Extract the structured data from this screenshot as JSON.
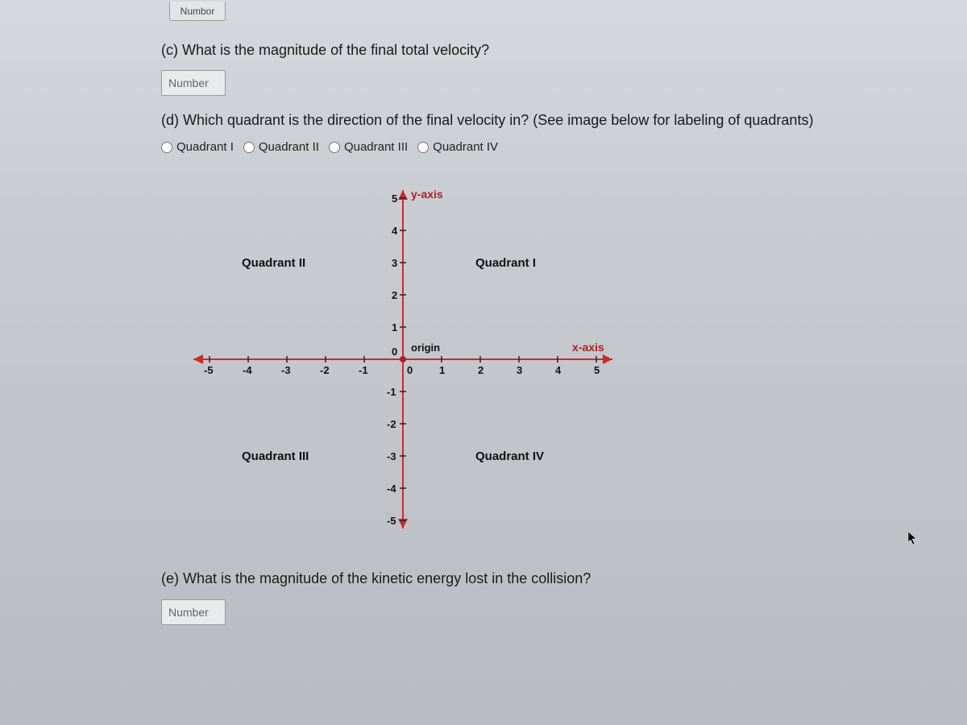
{
  "question_c": {
    "label": "(c) What is the magnitude of the final total velocity?",
    "input_placeholder": "Number"
  },
  "question_d": {
    "label": "(d) Which quadrant is the direction of the final velocity in? (See image below for labeling of quadrants)",
    "options": [
      "Quadrant I",
      "Quadrant II",
      "Quadrant III",
      "Quadrant IV"
    ]
  },
  "question_e": {
    "label": "(e) What is the magnitude of the kinetic energy lost in the collision?",
    "input_placeholder": "Number"
  },
  "chart_data": {
    "type": "line",
    "title": "",
    "x_axis_label": "x-axis",
    "y_axis_label": "y-axis",
    "origin_label": "origin",
    "x_ticks": [
      -5,
      -4,
      -3,
      -2,
      -1,
      0,
      1,
      2,
      3,
      4,
      5
    ],
    "y_ticks": [
      -5,
      -4,
      -3,
      -2,
      -1,
      0,
      1,
      2,
      3,
      4,
      5
    ],
    "xlim": [
      -5,
      5
    ],
    "ylim": [
      -5,
      5
    ],
    "quadrants": {
      "top_right": "Quadrant I",
      "top_left": "Quadrant II",
      "bottom_left": "Quadrant III",
      "bottom_right": "Quadrant IV"
    }
  },
  "top_clip": "Numbor"
}
